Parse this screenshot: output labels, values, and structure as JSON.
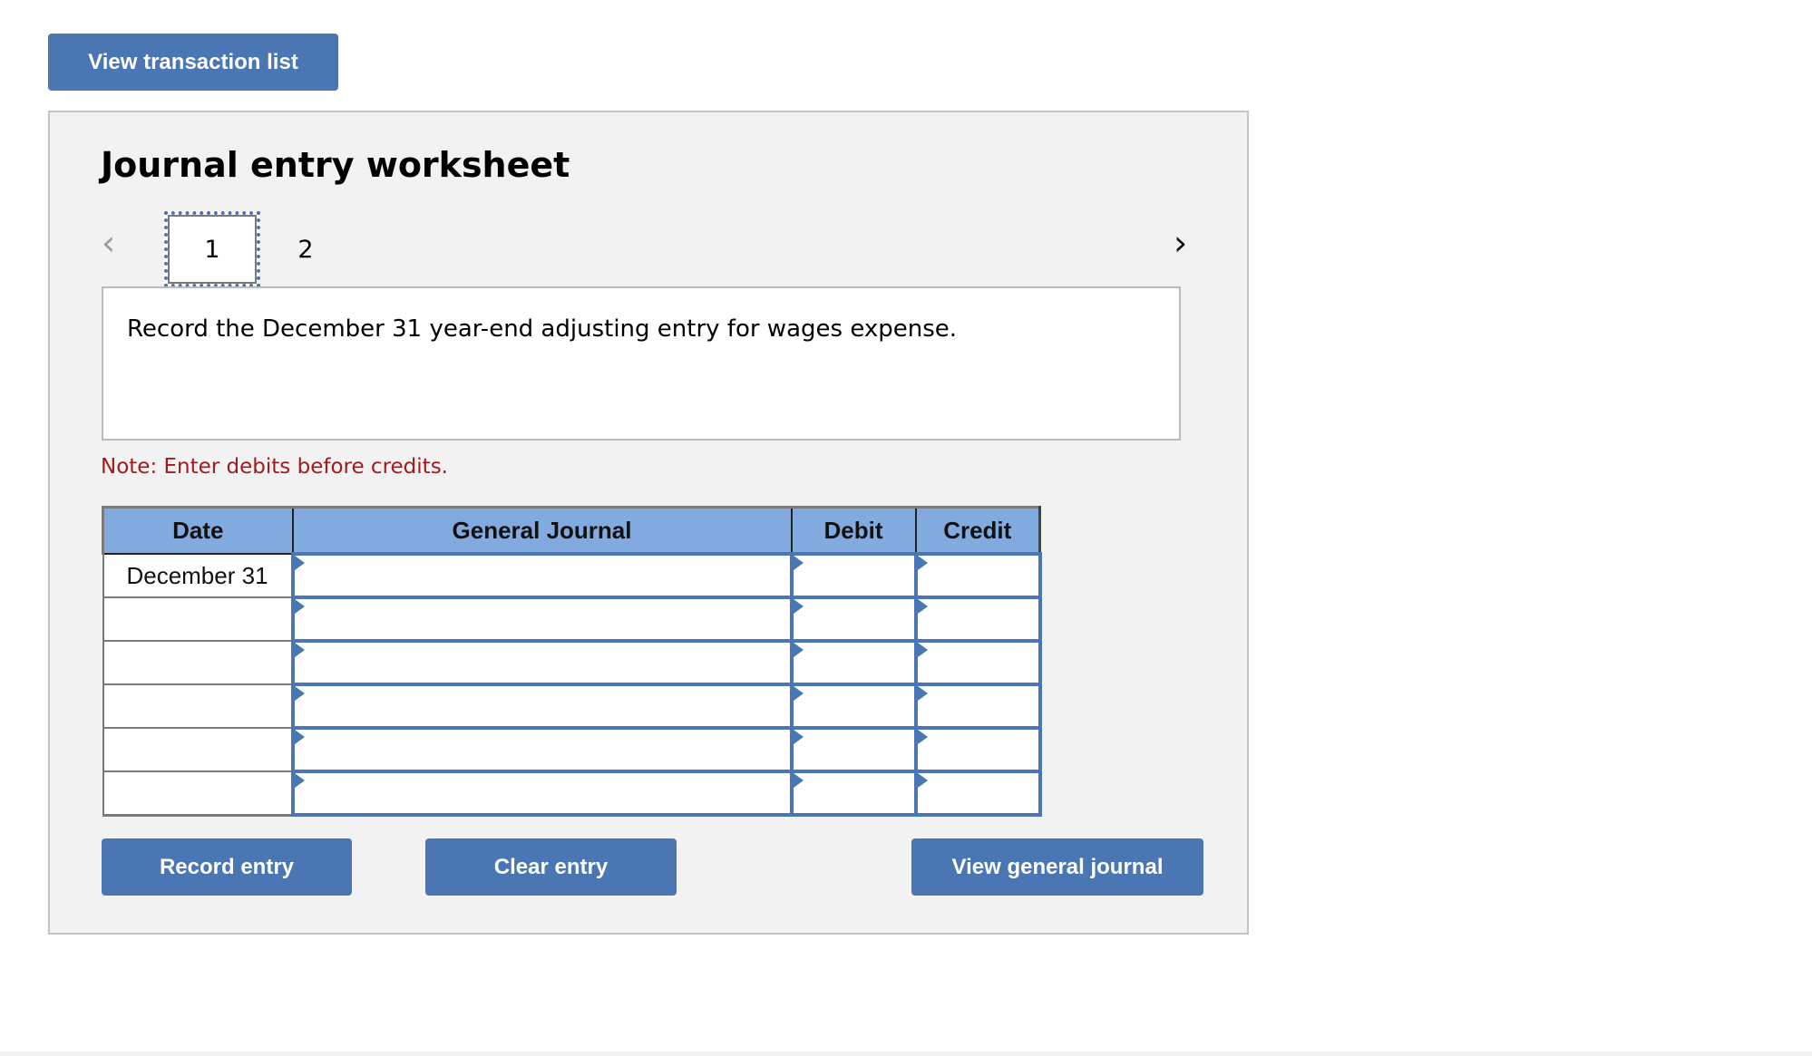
{
  "toolbar": {
    "view_transaction_list": "View transaction list"
  },
  "worksheet": {
    "title": "Journal entry worksheet",
    "nav": {
      "prev_icon": "chevron-left-icon",
      "next_icon": "chevron-right-icon",
      "prev_glyph": "‹",
      "next_glyph": "›"
    },
    "pages": [
      {
        "label": "1",
        "active": true
      },
      {
        "label": "2",
        "active": false
      }
    ],
    "instruction": "Record the December 31 year-end adjusting entry for wages expense.",
    "note": "Note: Enter debits before credits.",
    "table": {
      "headers": [
        "Date",
        "General Journal",
        "Debit",
        "Credit"
      ],
      "rows": [
        {
          "date": "December 31",
          "account": "",
          "debit": "",
          "credit": ""
        },
        {
          "date": "",
          "account": "",
          "debit": "",
          "credit": ""
        },
        {
          "date": "",
          "account": "",
          "debit": "",
          "credit": ""
        },
        {
          "date": "",
          "account": "",
          "debit": "",
          "credit": ""
        },
        {
          "date": "",
          "account": "",
          "debit": "",
          "credit": ""
        },
        {
          "date": "",
          "account": "",
          "debit": "",
          "credit": ""
        }
      ]
    },
    "buttons": {
      "record": "Record entry",
      "clear": "Clear entry",
      "view_general_journal": "View general journal"
    }
  },
  "colors": {
    "accent": "#4a76b4",
    "header_bg": "#83aadf",
    "panel_bg": "#f2f2f2",
    "note_text": "#a01c1c"
  }
}
